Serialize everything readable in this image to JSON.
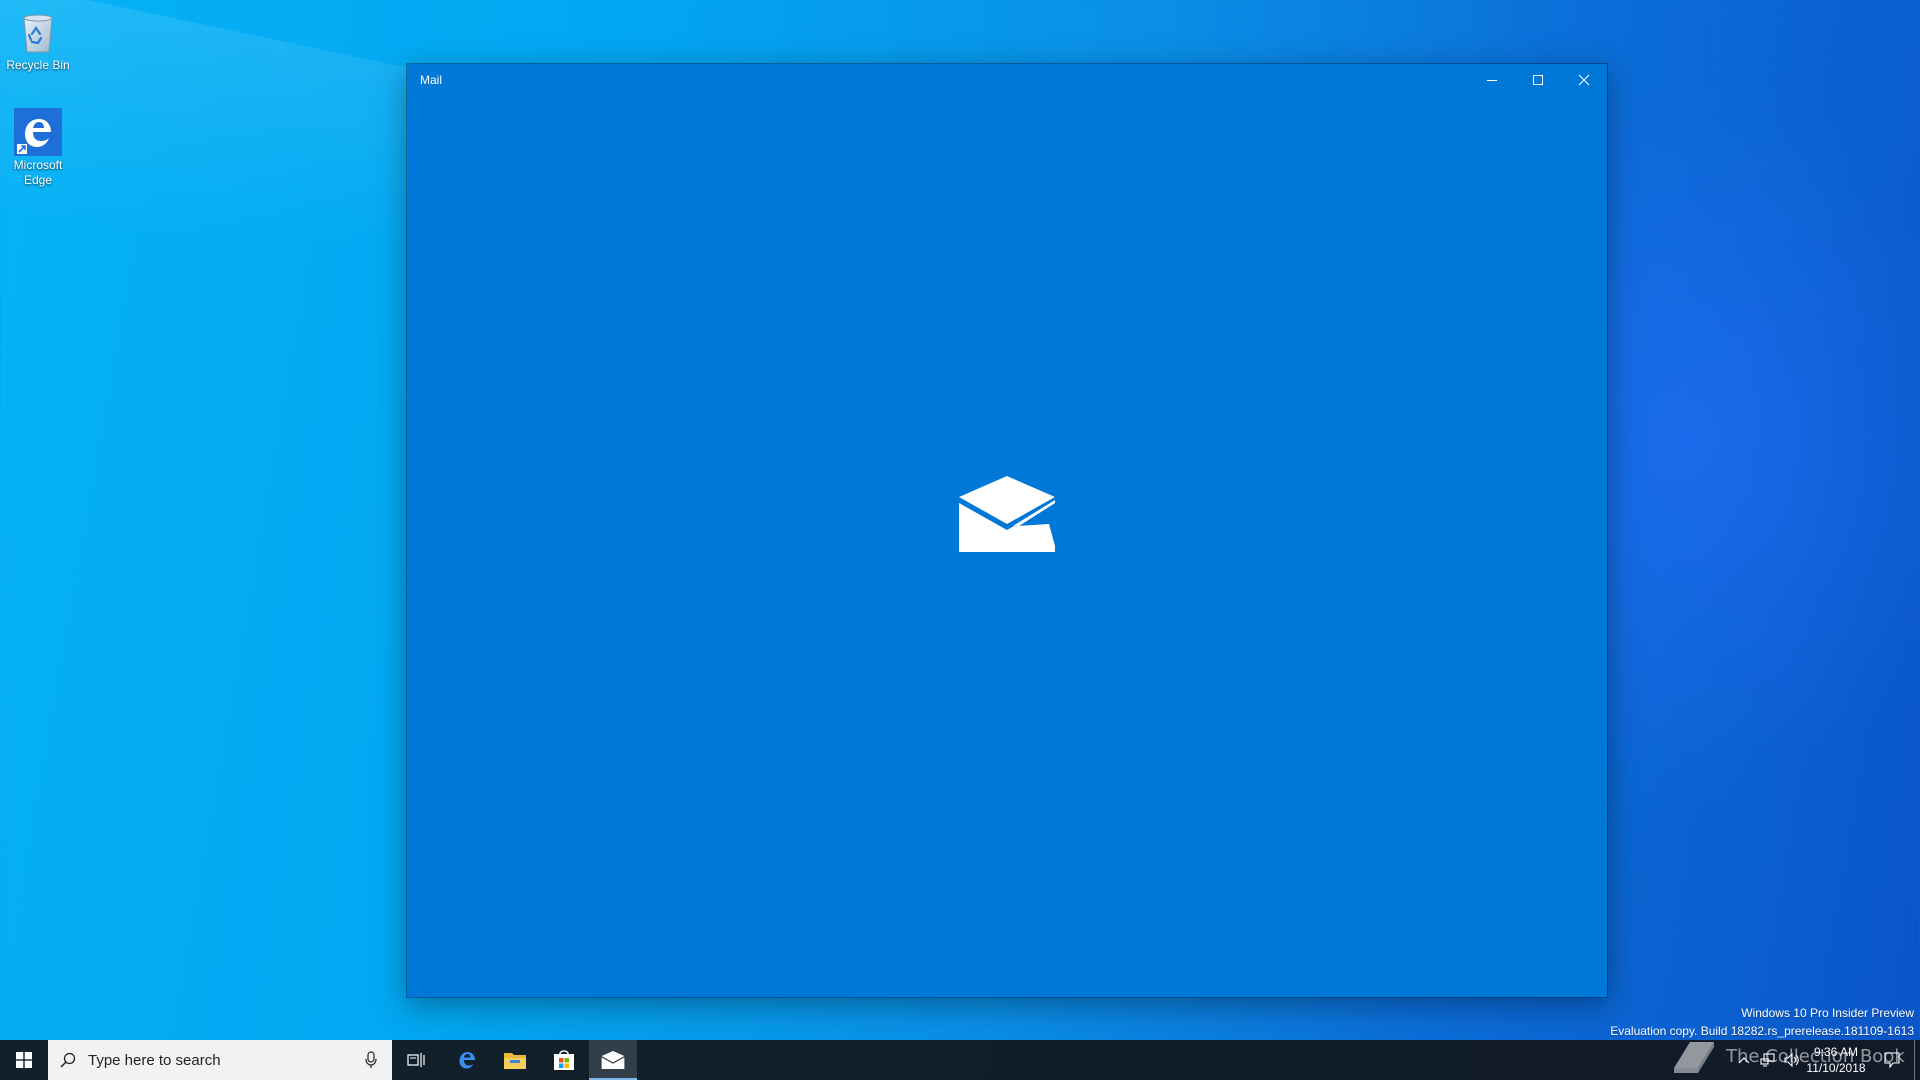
{
  "desktop": {
    "icons": [
      {
        "label": "Recycle Bin"
      },
      {
        "label": "Microsoft Edge"
      }
    ]
  },
  "window": {
    "title": "Mail",
    "minimize_icon": "minimize-icon",
    "maximize_icon": "maximize-icon",
    "close_icon": "close-icon",
    "background_color": "#0078d7",
    "splash_icon": "mail-envelope-icon"
  },
  "taskbar": {
    "search_placeholder": "Type here to search",
    "pinned": [
      "task-view-icon",
      "edge-icon",
      "file-explorer-icon",
      "store-icon",
      "mail-icon"
    ],
    "active_app": "Mail",
    "clock": {
      "time": "9:36 AM",
      "date": "11/10/2018"
    }
  },
  "watermark": {
    "line1": "Windows 10 Pro Insider Preview",
    "line2": "Evaluation copy. Build 18282.rs_prerelease.181109-1613"
  },
  "brand": {
    "text": "The Collection Book"
  }
}
